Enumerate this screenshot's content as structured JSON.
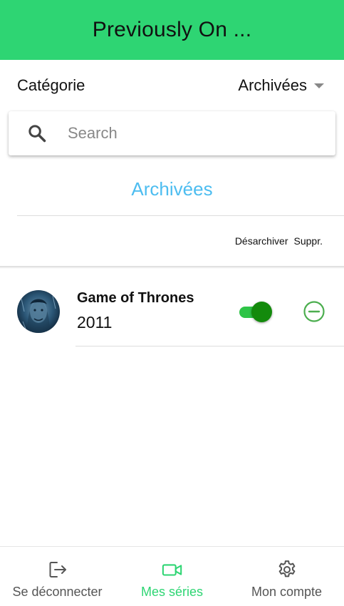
{
  "app_bar": {
    "title": "Previously On ..."
  },
  "category": {
    "label": "Catégorie",
    "selected": "Archivées"
  },
  "search": {
    "placeholder": "Search",
    "value": ""
  },
  "section": {
    "title": "Archivées",
    "columns": [
      "Désarchiver",
      "Suppr."
    ]
  },
  "series": [
    {
      "title": "Game of Thrones",
      "year": "2011",
      "archived": true
    }
  ],
  "bottom_nav": {
    "items": [
      {
        "label": "Se déconnecter",
        "icon": "logout-icon",
        "active": false
      },
      {
        "label": "Mes séries",
        "icon": "video-camera-icon",
        "active": true
      },
      {
        "label": "Mon compte",
        "icon": "gear-icon",
        "active": false
      }
    ]
  },
  "colors": {
    "primary": "#2ed573",
    "section_title": "#4dbdf0",
    "toggle_track": "#2ec447",
    "toggle_thumb": "#138a0c",
    "remove_icon": "#4cae4f"
  }
}
